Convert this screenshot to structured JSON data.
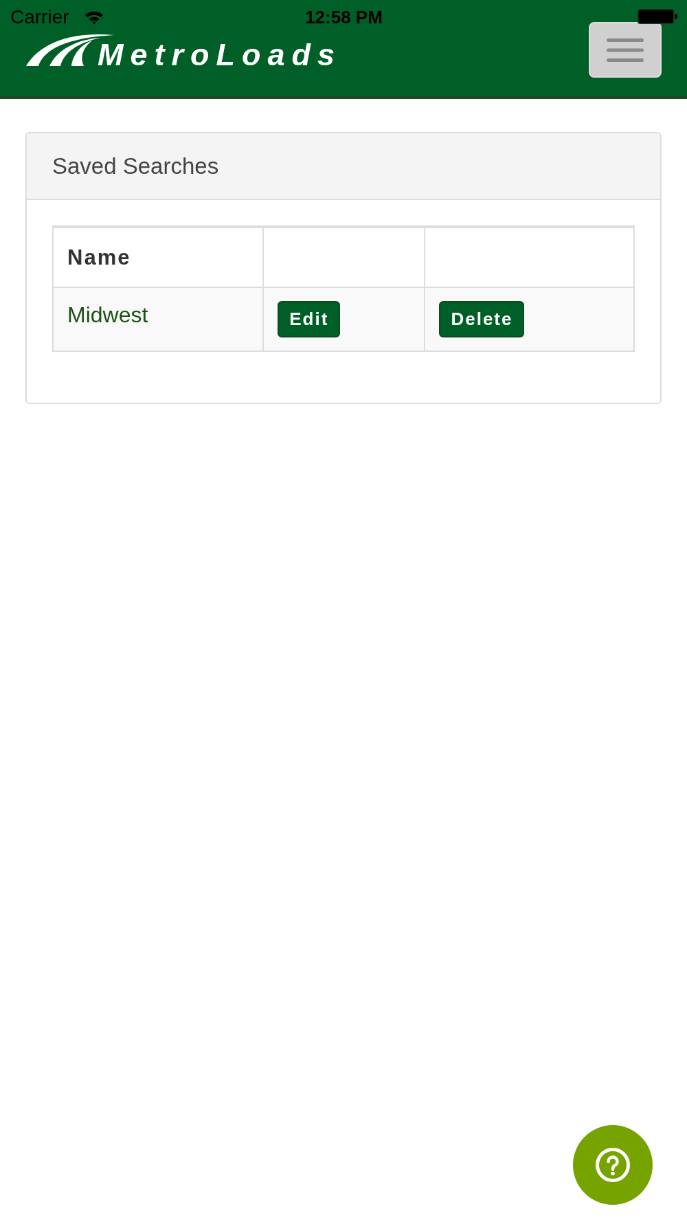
{
  "status_bar": {
    "carrier": "Carrier",
    "time": "12:58 PM"
  },
  "header": {
    "logo": "MetroLoads"
  },
  "panel": {
    "title": "Saved Searches",
    "table": {
      "columns": [
        "Name"
      ],
      "rows": [
        {
          "name": "Midwest",
          "actions": [
            "Edit",
            "Delete"
          ]
        }
      ]
    }
  }
}
